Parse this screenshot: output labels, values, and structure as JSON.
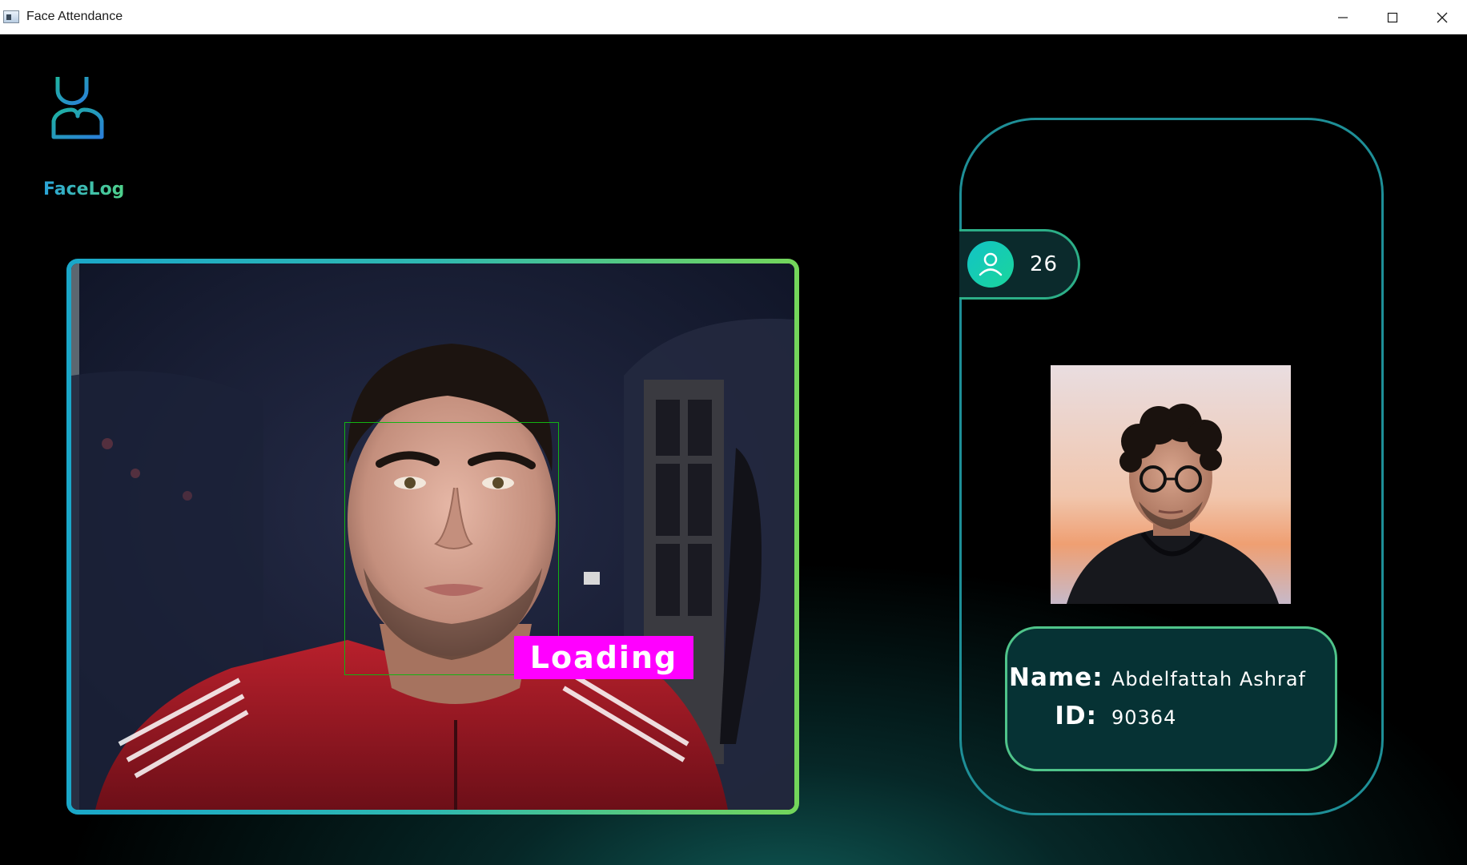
{
  "window": {
    "title": "Face Attendance",
    "minimize_glyph": "—",
    "maximize_glyph": "☐",
    "close_glyph": "✕"
  },
  "logo": {
    "text": "FaceLog",
    "icon": "graduate-icon"
  },
  "camera": {
    "status_label": "Loading",
    "status_color": "#ff00ff",
    "face_box_color": "#13b313"
  },
  "counter": {
    "icon": "user-avatar-icon",
    "value": "26"
  },
  "student": {
    "photo": "student-photo",
    "name_label": "Name:",
    "name_value": "Abdelfattah Ashraf",
    "id_label": "ID:",
    "id_value": "90364"
  },
  "colors": {
    "accent_cyan": "#1aa7c9",
    "accent_green": "#74d65a",
    "panel_border": "#1e8f97",
    "card_bg": "#063234"
  }
}
